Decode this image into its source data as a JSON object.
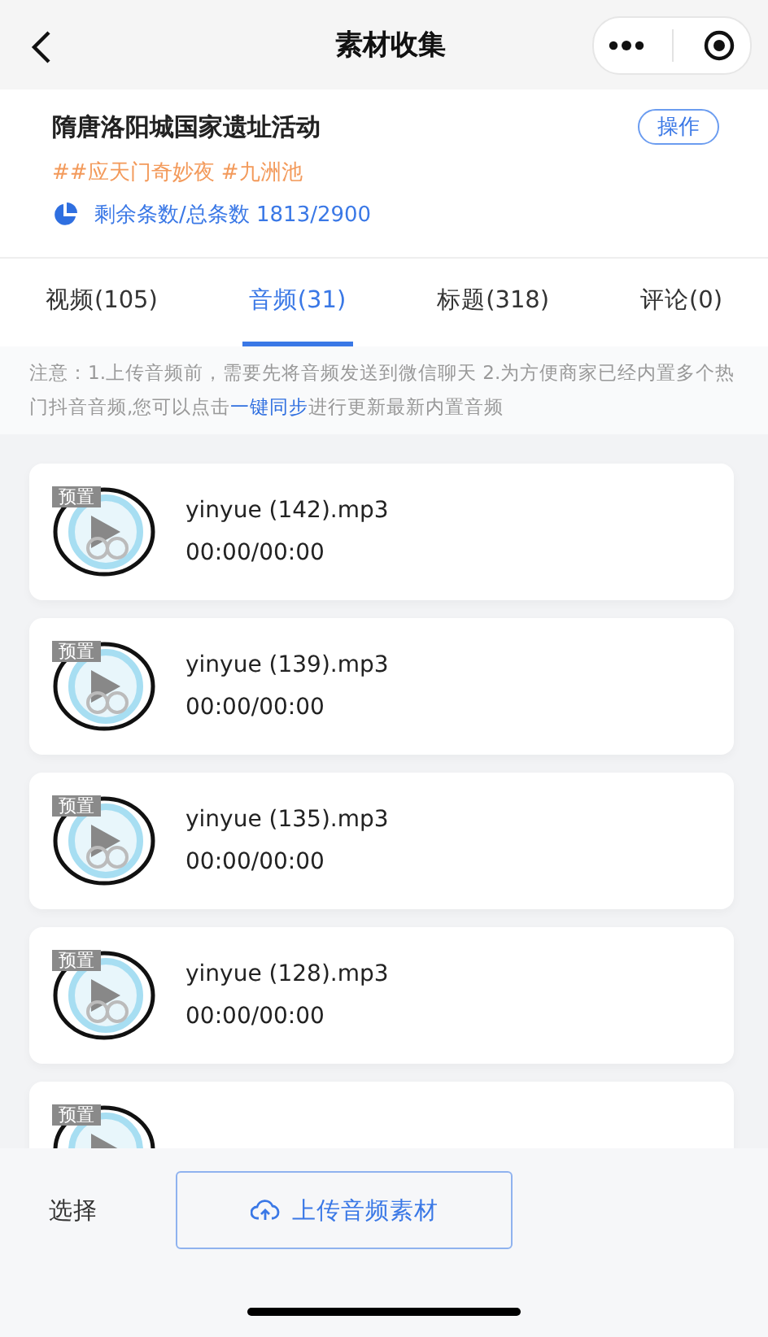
{
  "nav": {
    "title": "素材收集"
  },
  "activity": {
    "title": "隋唐洛阳城国家遗址活动",
    "action": "操作",
    "tags": "##应天门奇妙夜 #九洲池",
    "quota": "剩余条数/总条数 1813/2900"
  },
  "tabs": [
    {
      "label": "视频(105)",
      "selected": false
    },
    {
      "label": "音频(31)",
      "selected": true
    },
    {
      "label": "标题(318)",
      "selected": false
    },
    {
      "label": "评论(0)",
      "selected": false
    }
  ],
  "notice": {
    "before": "注意：1.上传音频前，需要先将音频发送到微信聊天 2.为方便商家已经内置多个热门抖音音频,您可以点击",
    "link": "一键同步",
    "after": "进行更新最新内置音频"
  },
  "items": [
    {
      "badge": "预置",
      "name": "yinyue (142).mp3",
      "time": "00:00/00:00"
    },
    {
      "badge": "预置",
      "name": "yinyue (139).mp3",
      "time": "00:00/00:00"
    },
    {
      "badge": "预置",
      "name": "yinyue (135).mp3",
      "time": "00:00/00:00"
    },
    {
      "badge": "预置",
      "name": "yinyue (128).mp3",
      "time": "00:00/00:00"
    },
    {
      "badge": "预置"
    }
  ],
  "bottom": {
    "select": "选择",
    "upload": "上传音频素材"
  }
}
